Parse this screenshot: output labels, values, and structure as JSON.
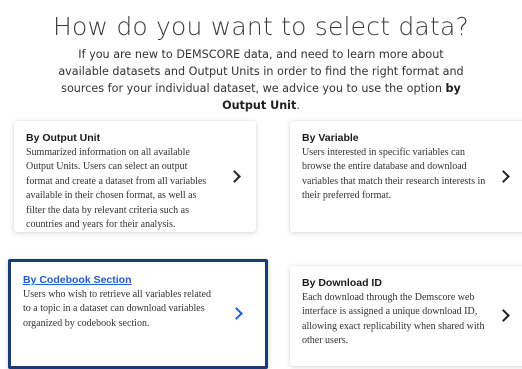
{
  "heading": "How do you want to select data?",
  "intro": {
    "text": "If you are new to DEMSCORE data, and need to learn more about available datasets and Output Units in order to find the right format and sources for your individual dataset, we advice you to use the option ",
    "bold": "by Output Unit",
    "end": "."
  },
  "cards": [
    {
      "title": "By Output Unit",
      "description": "Summarized information on all available Output Units. Users can select an output format and create a dataset from all variables available in their chosen format, as well as filter the data by relevant criteria such as countries and years for their analysis."
    },
    {
      "title": "By Variable",
      "description": "Users interested in specific variables can browse the entire database and download variables that match their research interests in their preferred format."
    },
    {
      "title": "By Codebook Section",
      "description": "Users who wish to retrieve all variables related to a topic in a dataset can download variables organized by codebook section."
    },
    {
      "title": "By Download ID",
      "description": "Each download through the Demscore web interface is assigned a unique download ID, allowing exact replicability when shared with other users."
    }
  ],
  "icons": {
    "arrow": "chevron-right-icon"
  },
  "colors": {
    "focus_border": "#1a3a7a",
    "link": "#1f5fd1"
  }
}
